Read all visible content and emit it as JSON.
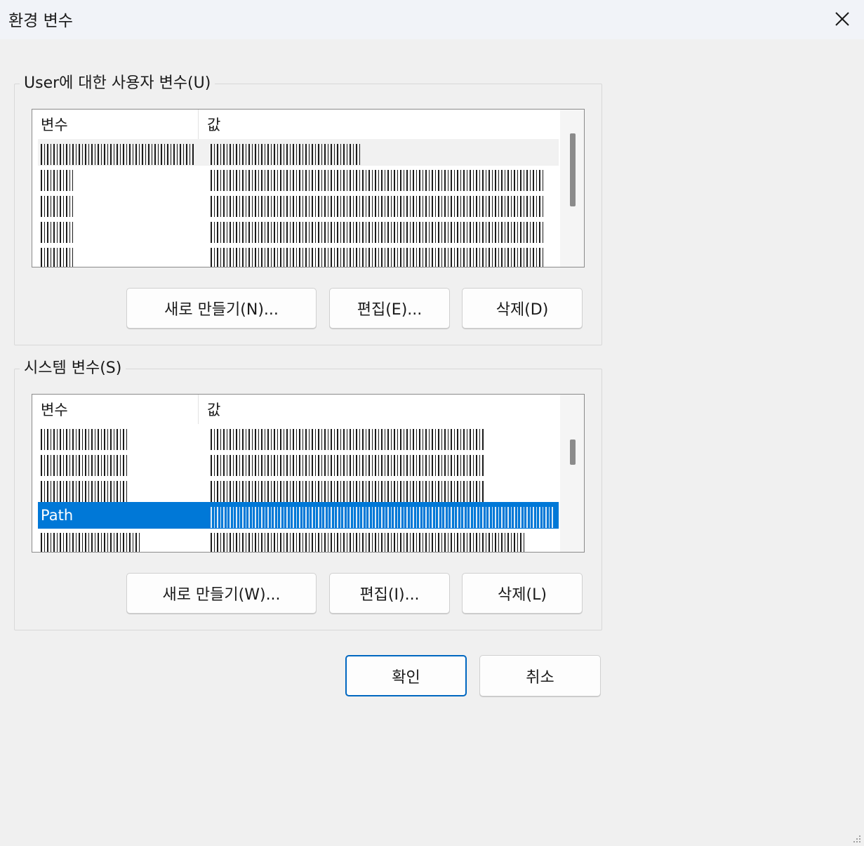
{
  "window": {
    "title": "환경 변수",
    "close_icon": "close-icon"
  },
  "user_group": {
    "label": "User에 대한 사용자 변수(U)",
    "columns": [
      "변수",
      "값"
    ],
    "rows": [
      {
        "name": "",
        "value": "",
        "state": "hover"
      },
      {
        "name": "",
        "value": "",
        "state": "normal"
      },
      {
        "name": "",
        "value": "",
        "state": "normal"
      },
      {
        "name": "",
        "value": "",
        "state": "normal"
      },
      {
        "name": "",
        "value": "",
        "state": "normal"
      }
    ],
    "buttons": {
      "new": "새로 만들기(N)...",
      "edit": "편집(E)...",
      "delete": "삭제(D)"
    }
  },
  "system_group": {
    "label": "시스템 변수(S)",
    "columns": [
      "변수",
      "값"
    ],
    "rows": [
      {
        "name": "",
        "value": "",
        "state": "normal"
      },
      {
        "name": "",
        "value": "",
        "state": "normal"
      },
      {
        "name": "",
        "value": "",
        "state": "normal"
      },
      {
        "name": "Path",
        "value": "",
        "state": "selected"
      },
      {
        "name": "",
        "value": "",
        "state": "normal"
      }
    ],
    "buttons": {
      "new": "새로 만들기(W)...",
      "edit": "편집(I)...",
      "delete": "삭제(L)"
    }
  },
  "dialog_buttons": {
    "ok": "확인",
    "cancel": "취소"
  },
  "colors": {
    "accent": "#0078d7",
    "primary_border": "#0067c0",
    "background": "#f0f0f0"
  }
}
